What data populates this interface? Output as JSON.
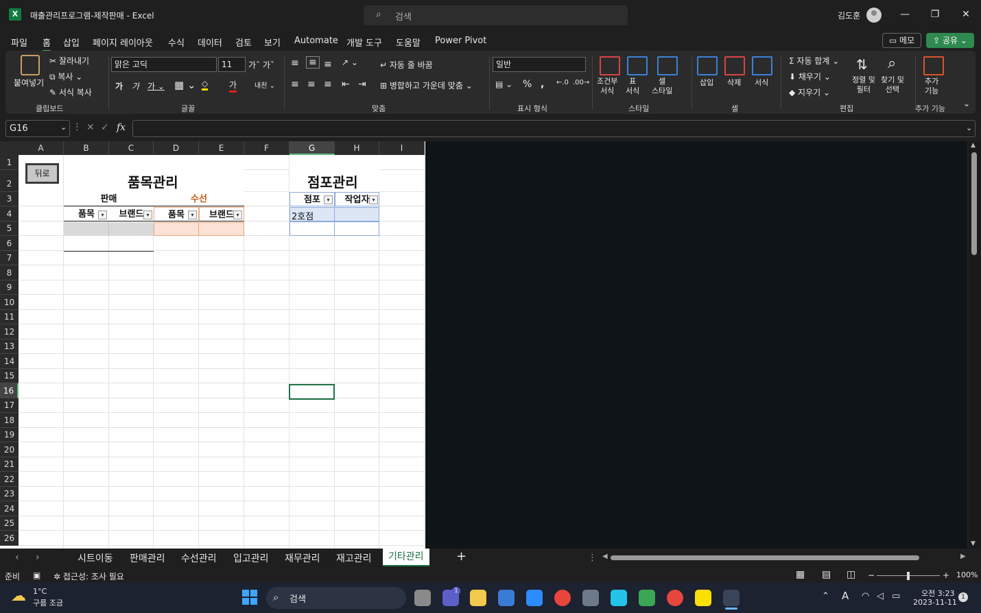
{
  "titlebar": {
    "app_logo": "X",
    "title": "매출관리프로그램-제작판매  -  Excel",
    "search_placeholder": "검색",
    "user_name": "김도훈",
    "min": "—",
    "restore": "❐",
    "close": "✕"
  },
  "menu": {
    "tabs": [
      "파일",
      "홈",
      "삽입",
      "페이지 레이아웃",
      "수식",
      "데이터",
      "검토",
      "보기",
      "Automate",
      "개발 도구",
      "도움말",
      "Power Pivot"
    ],
    "memo": "메모",
    "share": "공유"
  },
  "ribbon": {
    "paste": "붙여넣기",
    "cut": "잘라내기",
    "copy": "복사",
    "format_painter": "서식 복사",
    "clipboard": "클립보드",
    "font_name": "맑은 고딕",
    "font_size": "11",
    "font": "글꼴",
    "wrap_text": "자동 줄 바꿈",
    "merge_center": "병합하고 가운데 맞춤",
    "alignment": "맞춤",
    "number_format": "일반",
    "number": "표시 형식",
    "cond_format": "조건부\n서식",
    "table_format": "표\n서식",
    "cell_style": "셀\n스타일",
    "styles": "스타일",
    "insert": "삽입",
    "delete": "삭제",
    "format": "서식",
    "cells": "셀",
    "autosum": "자동 합계",
    "fill": "채우기",
    "clear": "지우기",
    "sort_filter": "정렬 및\n필터",
    "find_select": "찾기 및\n선택",
    "editing": "편집",
    "addins_btn": "추가\n기능",
    "addins": "추가 기능"
  },
  "formula_bar": {
    "name_box": "G16",
    "fx": "fx",
    "value": ""
  },
  "grid": {
    "columns": [
      "A",
      "B",
      "C",
      "D",
      "E",
      "F",
      "G",
      "H",
      "I"
    ],
    "rows": [
      "1",
      "2",
      "3",
      "4",
      "5",
      "6",
      "7",
      "8",
      "9",
      "10",
      "11",
      "12",
      "13",
      "14",
      "15",
      "16",
      "17",
      "18",
      "19",
      "20",
      "21",
      "22",
      "23",
      "24",
      "25",
      "26"
    ],
    "selected_col": "G",
    "selected_row": "16",
    "back_button": "뒤로",
    "item_title": "품목관리",
    "store_title": "점포관리",
    "sales_header": "판매",
    "repair_header": "수선",
    "item_col": "품목",
    "brand_col": "브랜드",
    "store_col": "점포",
    "worker_col": "작업자",
    "store_value": "2호점"
  },
  "sheets": {
    "tabs": [
      "시트이동",
      "판매관리",
      "수선관리",
      "입고관리",
      "재무관리",
      "재고관리",
      "기타관리"
    ],
    "active": "기타관리",
    "add": "+"
  },
  "status": {
    "ready": "준비",
    "accessibility": "접근성: 조사 필요",
    "zoom": "100%"
  },
  "taskbar": {
    "temperature": "1°C",
    "weather": "구름 조금",
    "search": "검색",
    "time": "오전 3:23",
    "date": "2023-11-11",
    "notifications": "1",
    "teams_badge": "1"
  },
  "colors": {
    "accent": "#1e7145",
    "sales_fill": "#d9d9d9",
    "repair_fill": "#fbe2d5",
    "store_fill": "#dce6f5",
    "repair_text": "#c55a11"
  }
}
